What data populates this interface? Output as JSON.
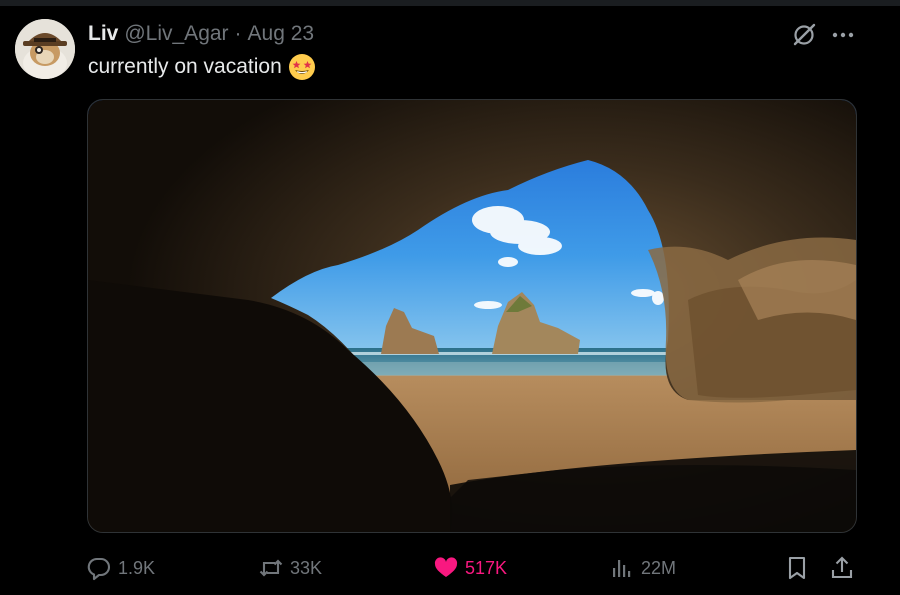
{
  "post": {
    "author": {
      "name": "Liv",
      "handle": "@Liv_Agar",
      "date": "Aug 23",
      "separator": "·"
    },
    "text": "currently on vacation",
    "text_emoji": "star-struck-emoji",
    "media": {
      "description_icon": "landscape-photo"
    }
  },
  "actions": {
    "replies": "1.9K",
    "reposts": "33K",
    "likes": "517K",
    "views": "22M"
  },
  "colors": {
    "background": "#000000",
    "text_primary": "#e7e9ea",
    "text_secondary": "#71767b",
    "like_active": "#f91880",
    "border": "#2f3336"
  },
  "icons": {
    "reply": "reply-icon",
    "repost": "repost-icon",
    "like": "heart-icon",
    "views": "views-chart-icon",
    "bookmark": "bookmark-icon",
    "share": "share-icon",
    "grok": "grok-icon",
    "more": "more-icon"
  }
}
